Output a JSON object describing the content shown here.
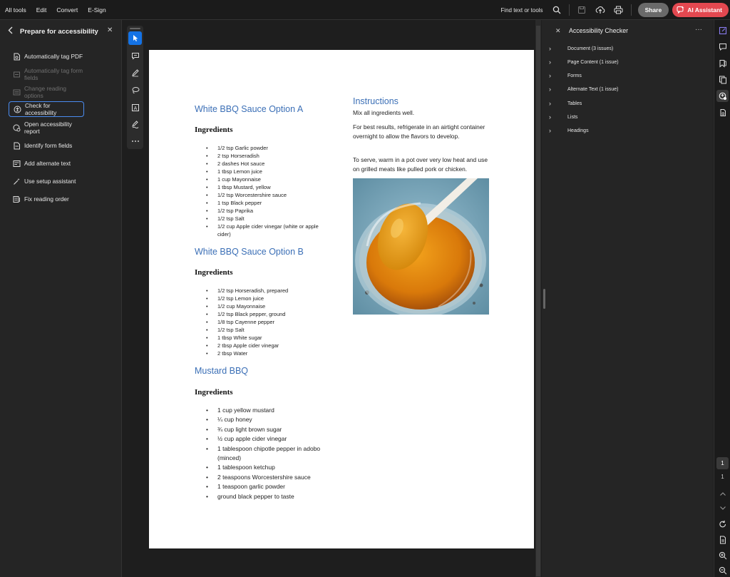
{
  "menu": [
    "All tools",
    "Edit",
    "Convert",
    "E-Sign"
  ],
  "topbar": {
    "find_label": "Find text or tools",
    "share_label": "Share",
    "ai_label": "AI Assistant",
    "icons": [
      "search-icon",
      "save-icon",
      "upload-icon",
      "print-icon"
    ]
  },
  "left_panel": {
    "title": "Prepare for accessibility",
    "items": [
      {
        "label": "Automatically tag PDF",
        "state": "enabled",
        "icon": "tag-pdf-icon"
      },
      {
        "label": "Automatically tag form fields",
        "state": "disabled",
        "icon": "tag-form-icon"
      },
      {
        "label": "Change reading options",
        "state": "disabled",
        "icon": "reading-options-icon"
      },
      {
        "label": "Check for accessibility",
        "state": "active",
        "icon": "accessibility-icon"
      },
      {
        "label": "Open accessibility report",
        "state": "enabled",
        "icon": "report-icon"
      },
      {
        "label": "Identify form fields",
        "state": "enabled",
        "icon": "form-fields-icon"
      },
      {
        "label": "Add alternate text",
        "state": "enabled",
        "icon": "alt-text-icon"
      },
      {
        "label": "Use setup assistant",
        "state": "enabled",
        "icon": "wand-icon"
      },
      {
        "label": "Fix reading order",
        "state": "enabled",
        "icon": "reading-order-icon"
      }
    ]
  },
  "quick_tools": [
    "select-icon",
    "comment-icon",
    "draw-icon",
    "lasso-icon",
    "text-box-icon",
    "sign-icon",
    "more-icon"
  ],
  "document": {
    "sections": [
      {
        "heading": "White BBQ Sauce Option A",
        "subheading": "Ingredients",
        "items": [
          "1/2 tsp Garlic powder",
          "2 tsp Horseradish",
          "2 dashes Hot sauce",
          "1 tbsp Lemon juice",
          "1 cup Mayonnaise",
          "1 tbsp Mustard, yellow",
          "1/2 tsp Worcestershire sauce",
          "1 tsp Black pepper",
          "1/2 tsp Paprika",
          "1/2 tsp Salt",
          "1/2 cup Apple cider vinegar (white or apple cider)"
        ]
      },
      {
        "heading": "White BBQ Sauce Option B",
        "subheading": "Ingredients",
        "items": [
          "1/2 tsp Horseradish, prepared",
          "1/2 tsp Lemon juice",
          "1/2 cup Mayonnaise",
          "1/2 tsp Black pepper, ground",
          "1/8 tsp Cayenne pepper",
          "1/2 tsp Salt",
          "1 tbsp White sugar",
          "2 tbsp Apple cider vinegar",
          "2 tbsp Water"
        ]
      },
      {
        "heading": "Mustard BBQ",
        "subheading": "Ingredients",
        "items": [
          "1 cup yellow mustard",
          "¼ cup honey",
          "¾ cup light brown sugar",
          "½ cup apple cider vinegar",
          "1 tablespoon chipotle pepper in adobo (minced)",
          "1 tablespoon ketchup",
          "2 teaspoons Worcestershire sauce",
          "1 teaspoon garlic powder",
          "ground black pepper to taste"
        ]
      }
    ],
    "instructions": {
      "heading": "Instructions",
      "paragraphs": [
        "Mix all ingredients well.",
        "For best results, refrigerate in an airtight container overnight to allow the flavors to develop.",
        "To serve, warm in a pot over very low heat and use on grilled meats like pulled pork or chicken."
      ]
    }
  },
  "right_panel": {
    "title": "Accessibility Checker",
    "items": [
      "Document (3 issues)",
      "Page Content (1 issue)",
      "Forms",
      "Alternate Text (1 issue)",
      "Tables",
      "Lists",
      "Headings"
    ]
  },
  "rail": {
    "icons": [
      "edit-pdf-icon",
      "comments-icon",
      "bookmarks-icon",
      "pages-icon",
      "accessibility-checker-icon",
      "attachments-icon"
    ],
    "page_current": "1",
    "page_total": "1",
    "bottom_icons": [
      "chevron-up-icon",
      "chevron-down-icon",
      "rotate-icon",
      "page-fit-icon",
      "zoom-in-icon",
      "zoom-out-icon"
    ]
  },
  "colors": {
    "accent": "#1473e6",
    "heading_blue": "#3b6fb6",
    "ai_red": "#e34850",
    "active_outline": "#4a8cf0"
  }
}
